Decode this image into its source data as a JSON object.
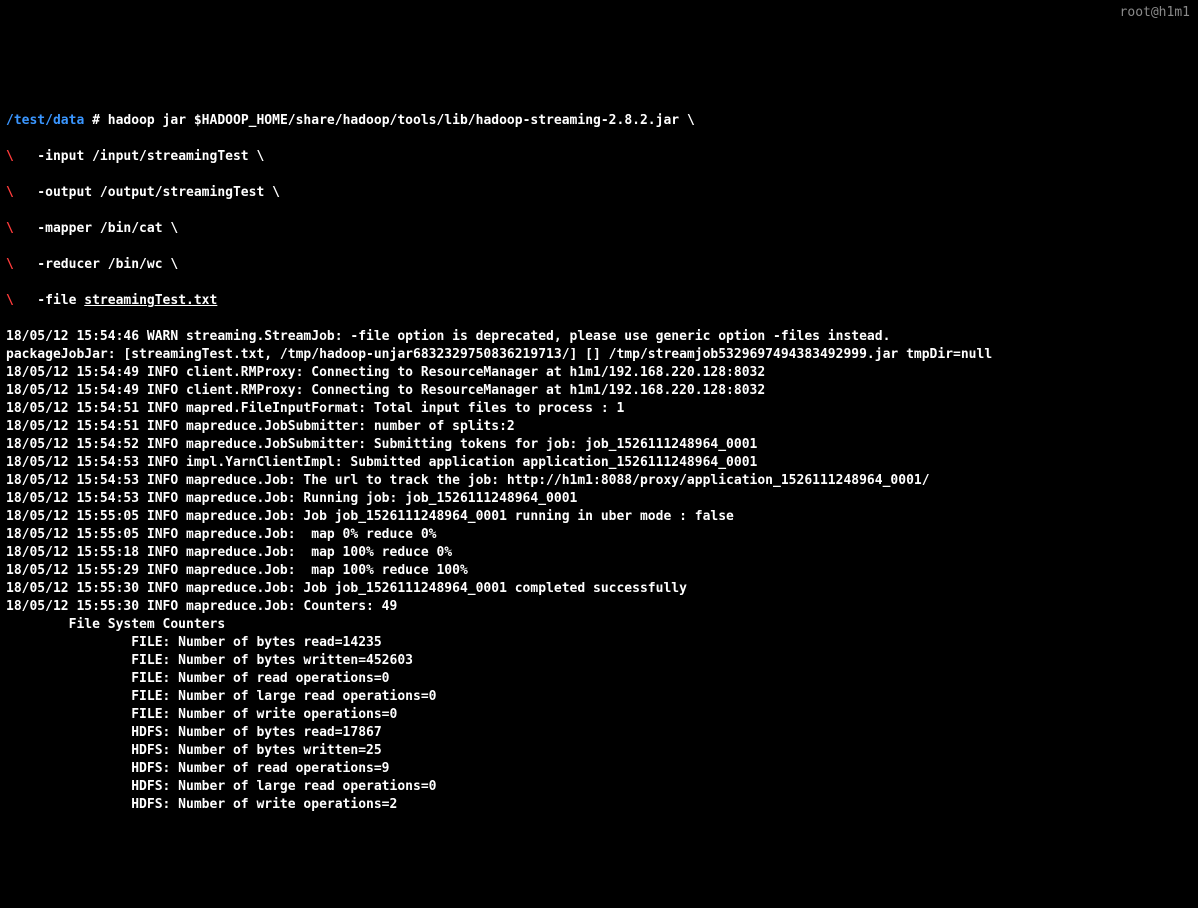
{
  "hostLabel": "root@h1m1",
  "prompt": {
    "cwd": "/test/data",
    "hash": " # "
  },
  "cmd": "hadoop jar $HADOOP_HOME/share/hadoop/tools/lib/hadoop-streaming-2.8.2.jar \\",
  "cont": [
    {
      "pre": "   -input /input/streamingTest \\"
    },
    {
      "pre": "   -output /output/streamingTest \\"
    },
    {
      "pre": "   -mapper /bin/cat \\"
    },
    {
      "pre": "   -reducer /bin/wc \\"
    },
    {
      "pre": "   -file ",
      "ul": "streamingTest.txt"
    }
  ],
  "output": [
    "18/05/12 15:54:46 WARN streaming.StreamJob: -file option is deprecated, please use generic option -files instead.",
    "packageJobJar: [streamingTest.txt, /tmp/hadoop-unjar6832329750836219713/] [] /tmp/streamjob5329697494383492999.jar tmpDir=null",
    "18/05/12 15:54:49 INFO client.RMProxy: Connecting to ResourceManager at h1m1/192.168.220.128:8032",
    "18/05/12 15:54:49 INFO client.RMProxy: Connecting to ResourceManager at h1m1/192.168.220.128:8032",
    "18/05/12 15:54:51 INFO mapred.FileInputFormat: Total input files to process : 1",
    "18/05/12 15:54:51 INFO mapreduce.JobSubmitter: number of splits:2",
    "18/05/12 15:54:52 INFO mapreduce.JobSubmitter: Submitting tokens for job: job_1526111248964_0001",
    "18/05/12 15:54:53 INFO impl.YarnClientImpl: Submitted application application_1526111248964_0001",
    "18/05/12 15:54:53 INFO mapreduce.Job: The url to track the job: http://h1m1:8088/proxy/application_1526111248964_0001/",
    "18/05/12 15:54:53 INFO mapreduce.Job: Running job: job_1526111248964_0001",
    "18/05/12 15:55:05 INFO mapreduce.Job: Job job_1526111248964_0001 running in uber mode : false",
    "18/05/12 15:55:05 INFO mapreduce.Job:  map 0% reduce 0%",
    "18/05/12 15:55:18 INFO mapreduce.Job:  map 100% reduce 0%",
    "18/05/12 15:55:29 INFO mapreduce.Job:  map 100% reduce 100%",
    "18/05/12 15:55:30 INFO mapreduce.Job: Job job_1526111248964_0001 completed successfully",
    "18/05/12 15:55:30 INFO mapreduce.Job: Counters: 49",
    "        File System Counters",
    "                FILE: Number of bytes read=14235",
    "                FILE: Number of bytes written=452603",
    "                FILE: Number of read operations=0",
    "                FILE: Number of large read operations=0",
    "                FILE: Number of write operations=0",
    "                HDFS: Number of bytes read=17867",
    "                HDFS: Number of bytes written=25",
    "                HDFS: Number of read operations=9",
    "                HDFS: Number of large read operations=0",
    "                HDFS: Number of write operations=2"
  ]
}
